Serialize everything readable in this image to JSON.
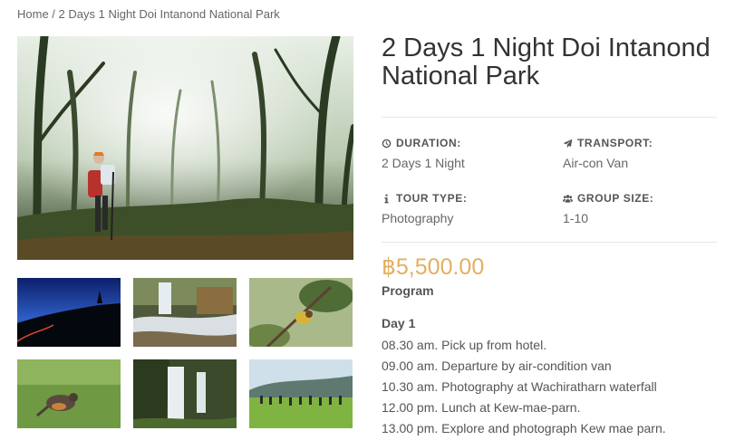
{
  "breadcrumb": {
    "home": "Home",
    "separator": " / ",
    "current": "2 Days 1 Night Doi Intanond National Park"
  },
  "tour": {
    "title": "2 Days 1 Night Doi Intanond National Park",
    "price": "฿5,500.00",
    "info": {
      "duration": {
        "label": "DURATION:",
        "value": "2 Days 1 Night",
        "icon": "clock-icon"
      },
      "transport": {
        "label": "TRANSPORT:",
        "value": "Air-con Van",
        "icon": "paper-plane-icon"
      },
      "tour_type": {
        "label": "TOUR TYPE:",
        "value": "Photography",
        "icon": "info-icon"
      },
      "group_size": {
        "label": "GROUP SIZE:",
        "value": "1-10",
        "icon": "users-icon"
      }
    }
  },
  "gallery": {
    "main": "misty forest hiker photo",
    "thumbnails": [
      "night pagoda",
      "mountain stream",
      "bird on branch",
      "bird on grass",
      "waterfall",
      "group in rice field"
    ]
  },
  "program": {
    "heading": "Program",
    "day_title": "Day 1",
    "schedule": [
      "08.30 am. Pick up from hotel.",
      "09.00 am. Departure by air-condition van",
      "10.30 am. Photography at Wachiratharn waterfall",
      "12.00 pm. Lunch at Kew-mae-parn.",
      "13.00 pm. Explore and photograph Kew mae parn."
    ]
  },
  "colors": {
    "price": "#e2b060",
    "title": "#333333",
    "text": "#555555"
  }
}
